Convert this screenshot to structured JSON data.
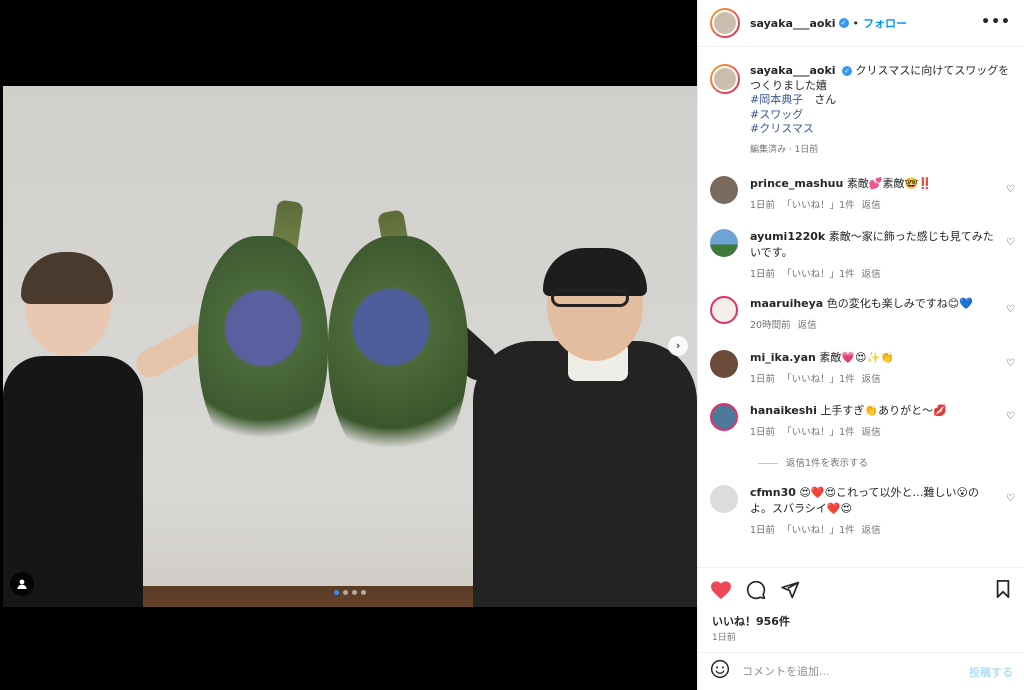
{
  "header": {
    "username": "sayaka___aoki",
    "separator": "•",
    "follow_label": "フォロー",
    "more_label": "•••"
  },
  "post": {
    "photo_alt": "",
    "nav_next": "›",
    "user_tag_icon": "person-icon",
    "carousel_count": 4,
    "carousel_active": 0
  },
  "caption": {
    "username": "sayaka___aoki",
    "text_line1": "クリスマスに向けてスワッグを",
    "text_line2": "つくりました嬉",
    "tag1": "#岡本典子",
    "tag1_suffix": "　さん",
    "tag2": "#スワッグ",
    "tag3": "#クリスマス",
    "meta": "編集済み · 1日前"
  },
  "comments": [
    {
      "user": "prince_mashuu",
      "text": "素敵💕素敵🤓‼️",
      "time": "1日前",
      "likes": "「いいね！」1件",
      "reply": "返信",
      "avatar_color": "#7a6a5e"
    },
    {
      "user": "ayumi1220k",
      "text": "素敵〜家に飾った感じも見てみたいです。",
      "time": "1日前",
      "likes": "「いいね！」1件",
      "reply": "返信",
      "avatar_color": "#3e6e9e"
    },
    {
      "user": "maaruiheya",
      "text": "色の変化も楽しみですね😊💙",
      "time": "20時間前",
      "likes": "",
      "reply": "返信",
      "avatar_color": "#f4eee8"
    },
    {
      "user": "mi_ika.yan",
      "text": "素敵💗😍✨👏",
      "time": "1日前",
      "likes": "「いいね！」1件",
      "reply": "返信",
      "avatar_color": "#6b4a3a"
    },
    {
      "user": "hanaikeshi",
      "text": "上手すぎ👏ありがと〜💋",
      "time": "1日前",
      "likes": "「いいね！」1件",
      "reply": "返信",
      "avatar_color": "#4d7a9a"
    },
    {
      "user": "cfmn30",
      "text": "😍❤️😍これって以外と…難しい😮のよ。スバラシイ❤️😍",
      "time": "1日前",
      "likes": "「いいね！」1件",
      "reply": "返信",
      "avatar_color": "#dcdcdc"
    }
  ],
  "view_replies": "返信1件を表示する",
  "actions": {
    "like_icon": "heart-icon",
    "comment_icon": "comment-icon",
    "share_icon": "share-icon",
    "save_icon": "bookmark-icon",
    "likes_label": "いいね！956件",
    "time": "1日前"
  },
  "add_comment": {
    "placeholder": "コメントを追加...",
    "post_label": "投稿する"
  },
  "colors": {
    "accent": "#0095f6",
    "like": "#ed4956",
    "muted": "#737373"
  }
}
